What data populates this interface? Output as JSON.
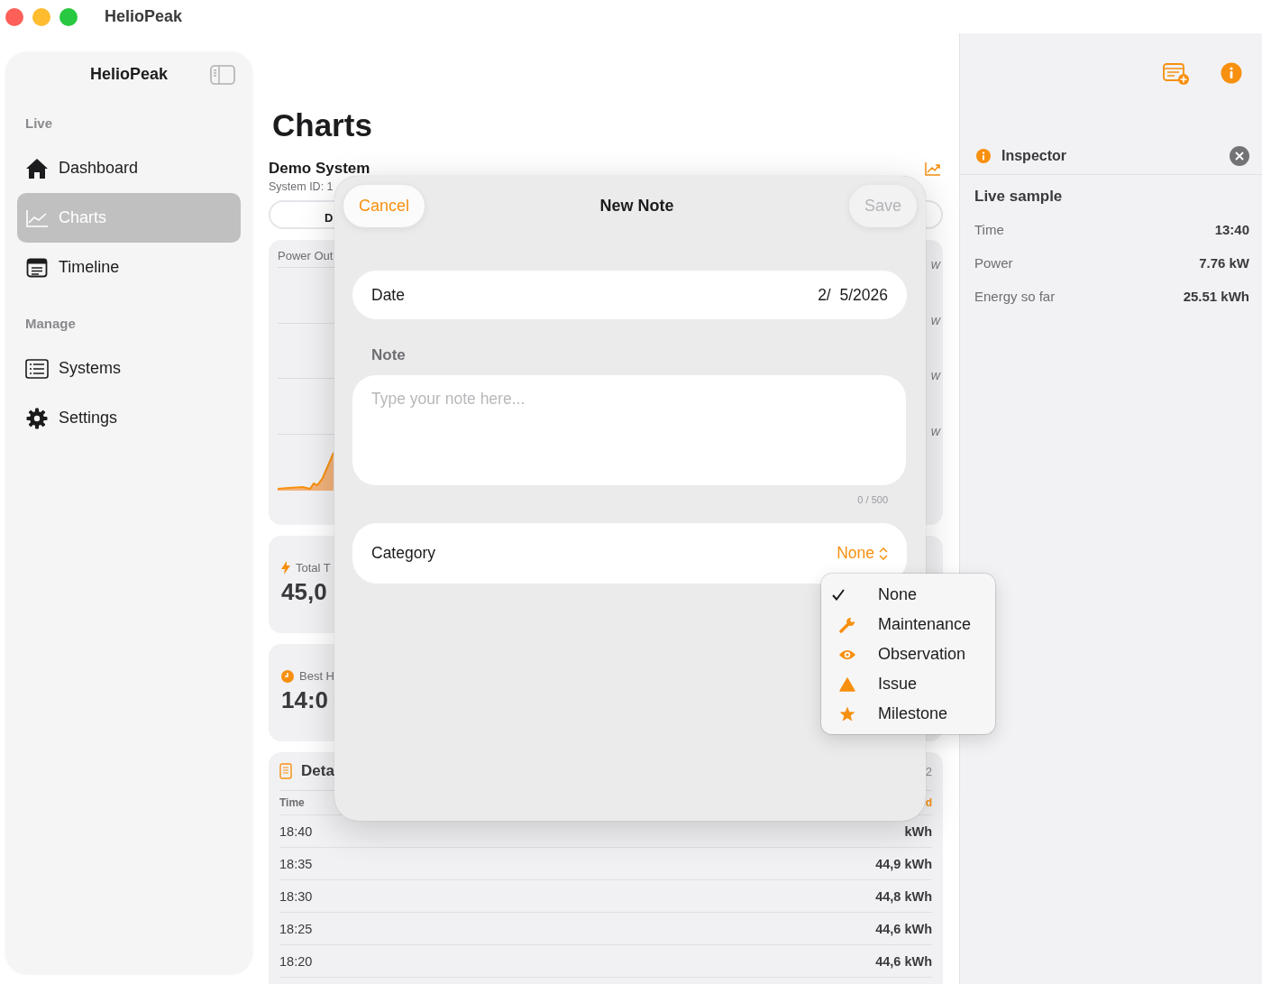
{
  "window": {
    "title": "HelioPeak"
  },
  "sidebar": {
    "title": "HelioPeak",
    "sections": [
      {
        "title": "Live",
        "items": [
          {
            "label": "Dashboard",
            "kind": "home",
            "selected": false
          },
          {
            "label": "Charts",
            "kind": "chart",
            "selected": true
          },
          {
            "label": "Timeline",
            "kind": "timeline",
            "selected": false
          }
        ]
      },
      {
        "title": "Manage",
        "items": [
          {
            "label": "Systems",
            "kind": "list",
            "selected": false
          },
          {
            "label": "Settings",
            "kind": "gear",
            "selected": false
          }
        ]
      }
    ]
  },
  "main": {
    "title": "Charts",
    "system_name": "Demo System",
    "system_id": "System ID: 1",
    "segments": [
      {
        "label": "D",
        "selected": true
      }
    ],
    "chart_card": {
      "title": "Power Out",
      "axis_labels": [
        "W",
        "W",
        "W",
        "W"
      ]
    },
    "stats": [
      {
        "kind": "bolt",
        "label": "Total T",
        "value": "45,0"
      },
      {
        "kind": "clock",
        "label": "Best H",
        "value": "14:0"
      }
    ],
    "details": {
      "title": "Deta",
      "count": "2",
      "columns": [
        "Time",
        "d"
      ],
      "rows": [
        [
          "18:40",
          "kWh"
        ],
        [
          "18:35",
          "44,9 kWh"
        ],
        [
          "18:30",
          "44,8 kWh"
        ],
        [
          "18:25",
          "44,6 kWh"
        ],
        [
          "18:20",
          "44,6 kWh"
        ]
      ]
    }
  },
  "sheet": {
    "title": "New Note",
    "cancel": "Cancel",
    "save": "Save",
    "save_disabled": true,
    "date_label": "Date",
    "date_value": "2/  5/2026",
    "note_label": "Note",
    "note_placeholder": "Type your note here...",
    "counter": "0 / 500",
    "category_label": "Category",
    "category_value": "None",
    "menu": [
      {
        "label": "None",
        "kind": "plain",
        "selected": true
      },
      {
        "label": "Maintenance",
        "kind": "wrench",
        "selected": false
      },
      {
        "label": "Observation",
        "kind": "eye",
        "selected": false
      },
      {
        "label": "Issue",
        "kind": "warning",
        "selected": false
      },
      {
        "label": "Milestone",
        "kind": "star",
        "selected": false
      }
    ]
  },
  "inspector": {
    "title": "Inspector",
    "section": "Live sample",
    "rows": [
      {
        "label": "Time",
        "value": "13:40"
      },
      {
        "label": "Power",
        "value": "7.76 kW"
      },
      {
        "label": "Energy so far",
        "value": "25.51 kWh"
      }
    ]
  }
}
